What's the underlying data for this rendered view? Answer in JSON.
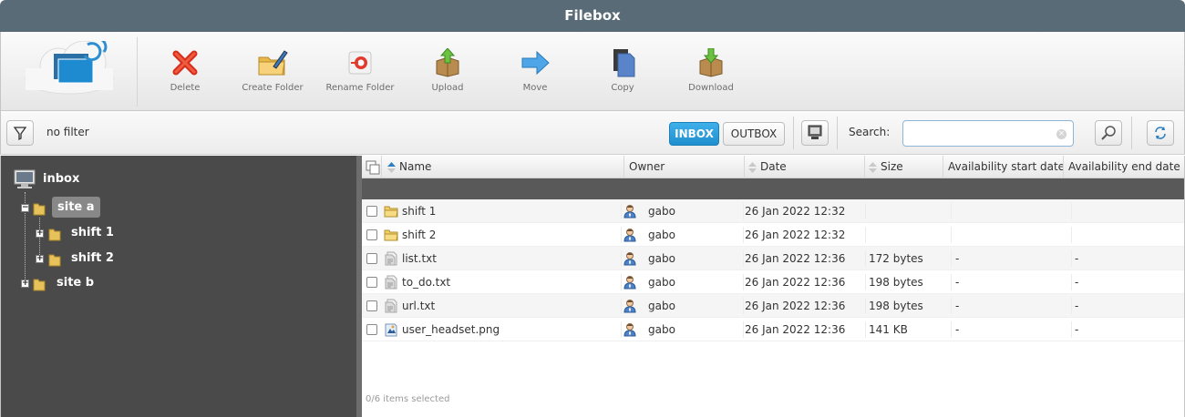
{
  "app": {
    "title": "Filebox"
  },
  "toolbar": {
    "delete_label": "Delete",
    "create_folder_label": "Create Folder",
    "rename_folder_label": "Rename Folder",
    "upload_label": "Upload",
    "move_label": "Move",
    "copy_label": "Copy",
    "download_label": "Download"
  },
  "filterbar": {
    "filter_text": "no filter",
    "inbox_label": "INBOX",
    "outbox_label": "OUTBOX",
    "search_label": "Search:",
    "search_value": ""
  },
  "tree": {
    "root": "inbox",
    "nodes": [
      {
        "label": "site a",
        "expanded": true,
        "selected": true
      },
      {
        "label": "shift 1",
        "expanded": false
      },
      {
        "label": "shift 2",
        "expanded": false
      },
      {
        "label": "site b",
        "expanded": false
      }
    ]
  },
  "grid": {
    "columns": [
      {
        "label": "Name"
      },
      {
        "label": "Owner"
      },
      {
        "label": "Date"
      },
      {
        "label": "Size"
      },
      {
        "label": "Availability start date"
      },
      {
        "label": "Availability end date"
      }
    ],
    "rows": [
      {
        "icon": "folder-icon",
        "name": "shift 1",
        "owner": "gabo",
        "date": "26 Jan 2022 12:32",
        "size": "",
        "start": "",
        "end": ""
      },
      {
        "icon": "folder-icon",
        "name": "shift 2",
        "owner": "gabo",
        "date": "26 Jan 2022 12:32",
        "size": "",
        "start": "",
        "end": ""
      },
      {
        "icon": "text-file-icon",
        "name": "list.txt",
        "owner": "gabo",
        "date": "26 Jan 2022 12:36",
        "size": "172 bytes",
        "start": "-",
        "end": "-"
      },
      {
        "icon": "text-file-icon",
        "name": "to_do.txt",
        "owner": "gabo",
        "date": "26 Jan 2022 12:36",
        "size": "198 bytes",
        "start": "-",
        "end": "-"
      },
      {
        "icon": "text-file-icon",
        "name": "url.txt",
        "owner": "gabo",
        "date": "26 Jan 2022 12:36",
        "size": "198 bytes",
        "start": "-",
        "end": "-"
      },
      {
        "icon": "image-file-icon",
        "name": "user_headset.png",
        "owner": "gabo",
        "date": "26 Jan 2022 12:36",
        "size": "141 KB",
        "start": "-",
        "end": "-"
      }
    ],
    "footer": "0/6 items selected"
  },
  "colors": {
    "accent": "#1f8fcf",
    "titlebar": "#5a6b78",
    "tree_bg": "#4a4a4a"
  }
}
